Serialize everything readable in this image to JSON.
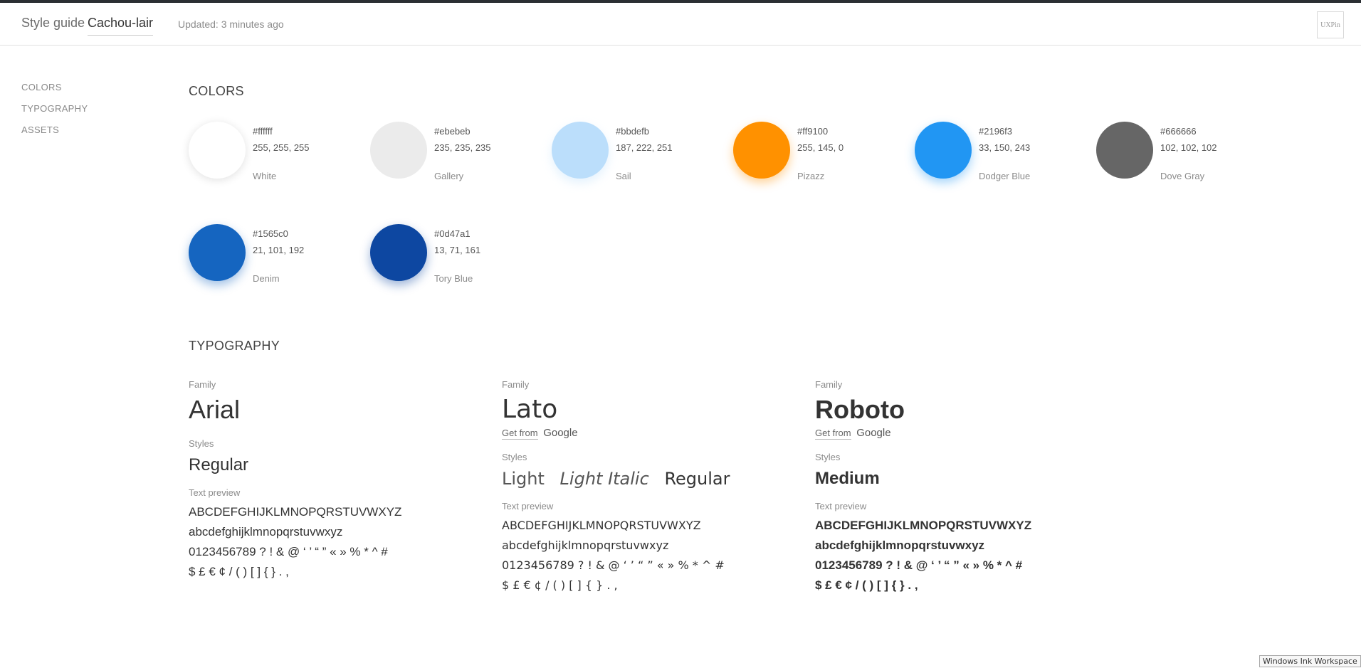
{
  "header": {
    "brand": "Style guide",
    "project_name": "Cachou-lair",
    "updated": "Updated: 3 minutes ago",
    "logo_text": "UXPin"
  },
  "sidebar": {
    "items": [
      {
        "label": "COLORS"
      },
      {
        "label": "TYPOGRAPHY"
      },
      {
        "label": "ASSETS"
      }
    ]
  },
  "colors": {
    "title": "COLORS",
    "swatches": [
      {
        "hex": "#ffffff",
        "rgb": "255, 255, 255",
        "name": "White",
        "color": "#ffffff"
      },
      {
        "hex": "#ebebeb",
        "rgb": "235, 235, 235",
        "name": "Gallery",
        "color": "#ebebeb"
      },
      {
        "hex": "#bbdefb",
        "rgb": "187, 222, 251",
        "name": "Sail",
        "color": "#bbdefb"
      },
      {
        "hex": "#ff9100",
        "rgb": "255, 145, 0",
        "name": "Pizazz",
        "color": "#ff9100"
      },
      {
        "hex": "#2196f3",
        "rgb": "33, 150, 243",
        "name": "Dodger Blue",
        "color": "#2196f3"
      },
      {
        "hex": "#666666",
        "rgb": "102, 102, 102",
        "name": "Dove Gray",
        "color": "#666666"
      },
      {
        "hex": "#1565c0",
        "rgb": "21, 101, 192",
        "name": "Denim",
        "color": "#1565c0"
      },
      {
        "hex": "#0d47a1",
        "rgb": "13, 71, 161",
        "name": "Tory Blue",
        "color": "#0d47a1"
      }
    ]
  },
  "typography": {
    "title": "TYPOGRAPHY",
    "family_label": "Family",
    "styles_label": "Styles",
    "preview_label": "Text preview",
    "get_from": "Get from",
    "google": "Google",
    "fonts": [
      {
        "family": "Arial",
        "styles": [
          "Regular"
        ]
      },
      {
        "family": "Lato",
        "styles": [
          "Light",
          "Light Italic",
          "Regular"
        ]
      },
      {
        "family": "Roboto",
        "styles": [
          "Medium"
        ]
      }
    ],
    "preview_lines": [
      "ABCDEFGHIJKLMNOPQRSTUVWXYZ",
      "abcdefghijklmnopqrstuvwxyz",
      "0123456789 ? ! & @ ‘ ’ “ ” « » % * ^ #",
      "$ £ € ¢ / ( ) [ ] { } . ,"
    ]
  },
  "taskbar": {
    "ink_workspace": "Windows Ink Workspace"
  }
}
